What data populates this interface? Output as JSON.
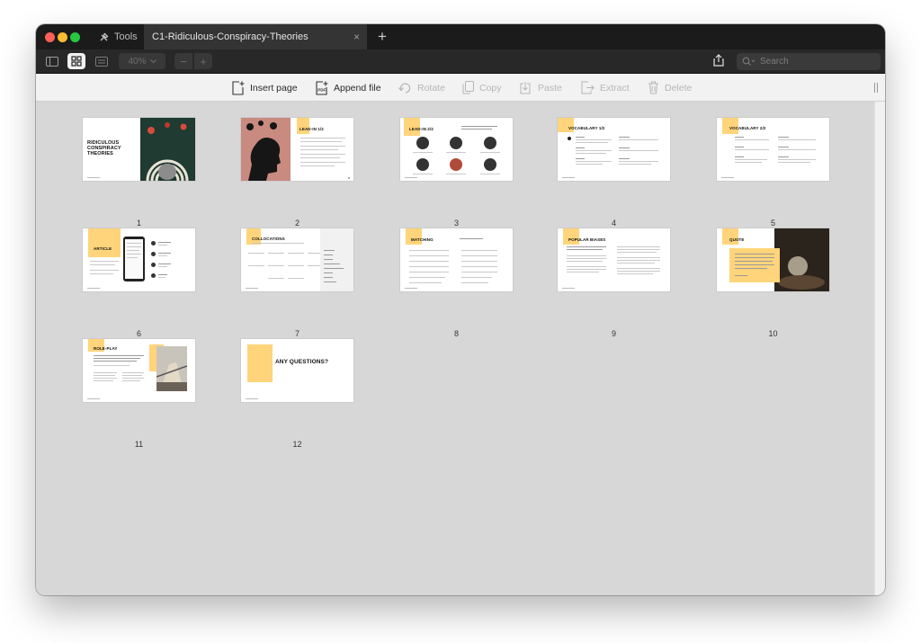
{
  "tabs": {
    "tools_label": "Tools",
    "document_title": "C1-Ridiculous-Conspiracy-Theories",
    "close_glyph": "×",
    "new_tab_glyph": "+"
  },
  "toolbar": {
    "zoom_value": "40%",
    "zoom_minus": "−",
    "zoom_plus": "+",
    "search_placeholder": "Search"
  },
  "actions": {
    "insert_page": "Insert page",
    "append_file": "Append file",
    "rotate": "Rotate",
    "copy": "Copy",
    "paste": "Paste",
    "extract": "Extract",
    "delete": "Delete"
  },
  "pages": [
    {
      "number": "1",
      "title_lines": [
        "RIDICULOUS",
        "CONSPIRACY",
        "THEORIES"
      ]
    },
    {
      "number": "2",
      "title": "LEAD-IN 1/2"
    },
    {
      "number": "3",
      "title": "LEAD-IN 2/2"
    },
    {
      "number": "4",
      "title": "VOCABULARY 1/2"
    },
    {
      "number": "5",
      "title": "VOCABULARY 2/2"
    },
    {
      "number": "6",
      "title": "ARTICLE"
    },
    {
      "number": "7",
      "title": "COLLOCATIONS"
    },
    {
      "number": "8",
      "title": "MATCHING"
    },
    {
      "number": "9",
      "title": "POPULAR BIASES"
    },
    {
      "number": "10",
      "title": "QUOTE"
    },
    {
      "number": "11",
      "title": "ROLE-PLAY"
    },
    {
      "number": "12",
      "title": "ANY QUESTIONS?"
    }
  ],
  "colors": {
    "accent_yellow": "#ffd47a",
    "titlebar": "#1b1b1b",
    "toolbar": "#282828",
    "canvas": "#d7d7d7"
  },
  "icons": [
    "tools-icon",
    "sidebar-icon",
    "grid-view-icon",
    "single-page-icon",
    "share-icon",
    "search-icon",
    "insert-page-icon",
    "append-file-icon",
    "rotate-icon",
    "copy-icon",
    "paste-icon",
    "extract-icon",
    "delete-icon"
  ]
}
